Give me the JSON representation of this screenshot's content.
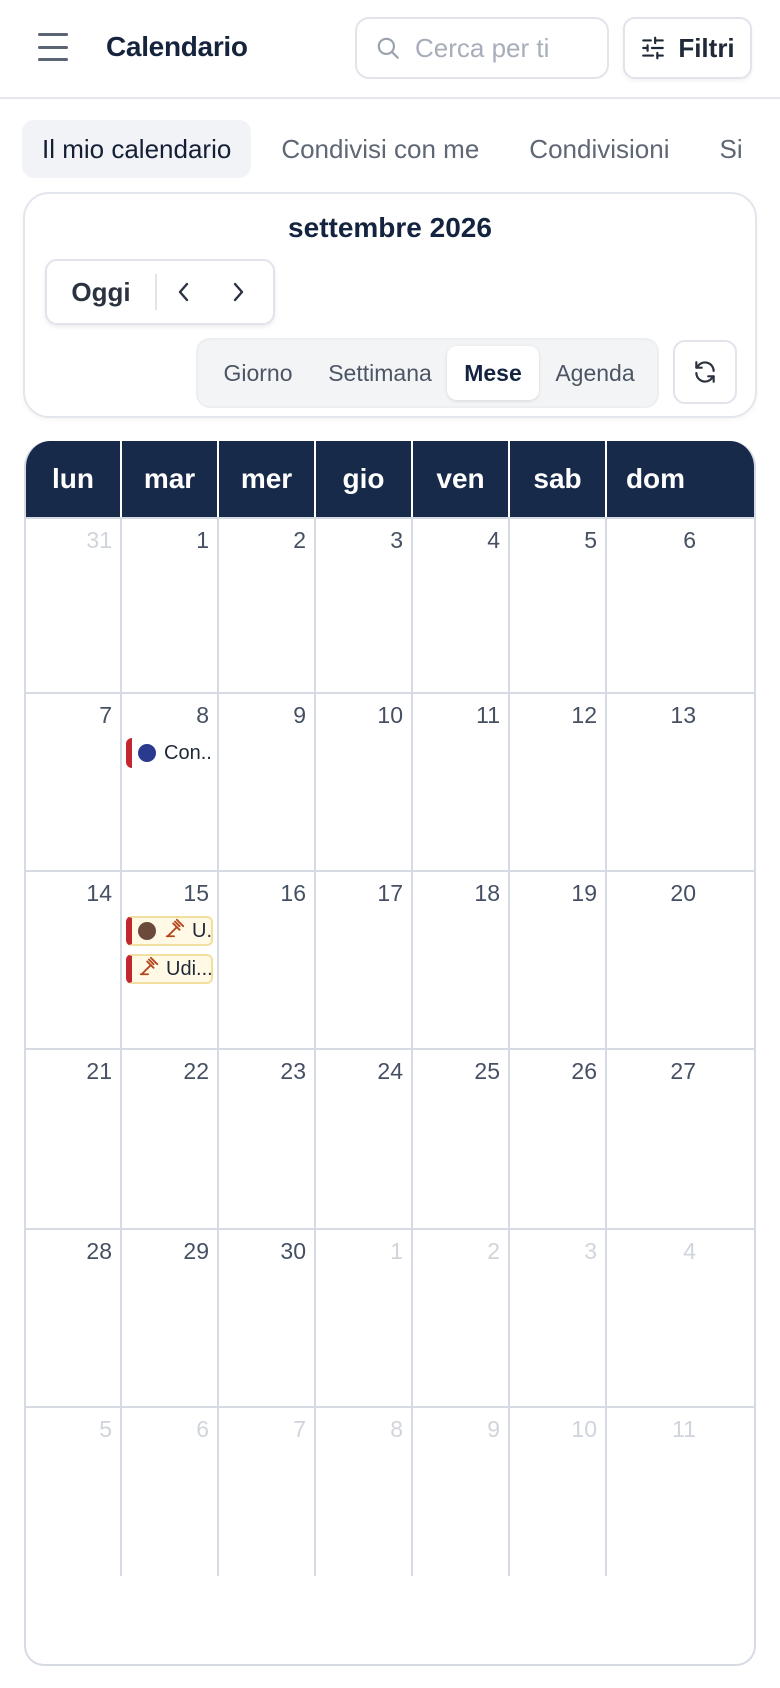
{
  "header": {
    "menu_icon": "hamburger-menu-icon",
    "title": "Calendario",
    "search_placeholder": "Cerca per ti",
    "filters_label": "Filtri"
  },
  "tabs": [
    {
      "label": "Il mio calendario",
      "active": true
    },
    {
      "label": "Condivisi con me",
      "active": false
    },
    {
      "label": "Condivisioni",
      "active": false
    },
    {
      "label": "Si",
      "active": false
    }
  ],
  "toolbar": {
    "month_title": "settembre 2026",
    "today_label": "Oggi",
    "views": [
      {
        "label": "Giorno",
        "active": false
      },
      {
        "label": "Settimana",
        "active": false
      },
      {
        "label": "Mese",
        "active": true
      },
      {
        "label": "Agenda",
        "active": false
      }
    ]
  },
  "calendar": {
    "weekdays": [
      "lun",
      "mar",
      "mer",
      "gio",
      "ven",
      "sab",
      "dom"
    ],
    "weeks": [
      [
        {
          "d": "31",
          "other": true
        },
        {
          "d": "1"
        },
        {
          "d": "2"
        },
        {
          "d": "3"
        },
        {
          "d": "4"
        },
        {
          "d": "5"
        },
        {
          "d": "6"
        }
      ],
      [
        {
          "d": "7"
        },
        {
          "d": "8",
          "events": [
            {
              "label": "Con...",
              "dot": "#2b3a8f",
              "type": "normal"
            }
          ]
        },
        {
          "d": "9"
        },
        {
          "d": "10"
        },
        {
          "d": "11"
        },
        {
          "d": "12"
        },
        {
          "d": "13"
        }
      ],
      [
        {
          "d": "14"
        },
        {
          "d": "15",
          "events": [
            {
              "label": "U..",
              "dot": "#6b4a3c",
              "gavel": true,
              "type": "hearing"
            },
            {
              "label": "Udi...",
              "gavel": true,
              "type": "hearing"
            }
          ]
        },
        {
          "d": "16"
        },
        {
          "d": "17"
        },
        {
          "d": "18"
        },
        {
          "d": "19"
        },
        {
          "d": "20"
        }
      ],
      [
        {
          "d": "21"
        },
        {
          "d": "22"
        },
        {
          "d": "23"
        },
        {
          "d": "24"
        },
        {
          "d": "25"
        },
        {
          "d": "26"
        },
        {
          "d": "27"
        }
      ],
      [
        {
          "d": "28"
        },
        {
          "d": "29"
        },
        {
          "d": "30"
        },
        {
          "d": "1",
          "other": true
        },
        {
          "d": "2",
          "other": true
        },
        {
          "d": "3",
          "other": true
        },
        {
          "d": "4",
          "other": true
        }
      ],
      [
        {
          "d": "5",
          "other": true
        },
        {
          "d": "6",
          "other": true
        },
        {
          "d": "7",
          "other": true
        },
        {
          "d": "8",
          "other": true
        },
        {
          "d": "9",
          "other": true
        },
        {
          "d": "10",
          "other": true
        },
        {
          "d": "11",
          "other": true
        }
      ]
    ]
  },
  "colors": {
    "header_bg": "#182a4a",
    "event_border": "#c2272d",
    "hearing_bg": "#fff9e6",
    "gavel": "#b5471e"
  }
}
